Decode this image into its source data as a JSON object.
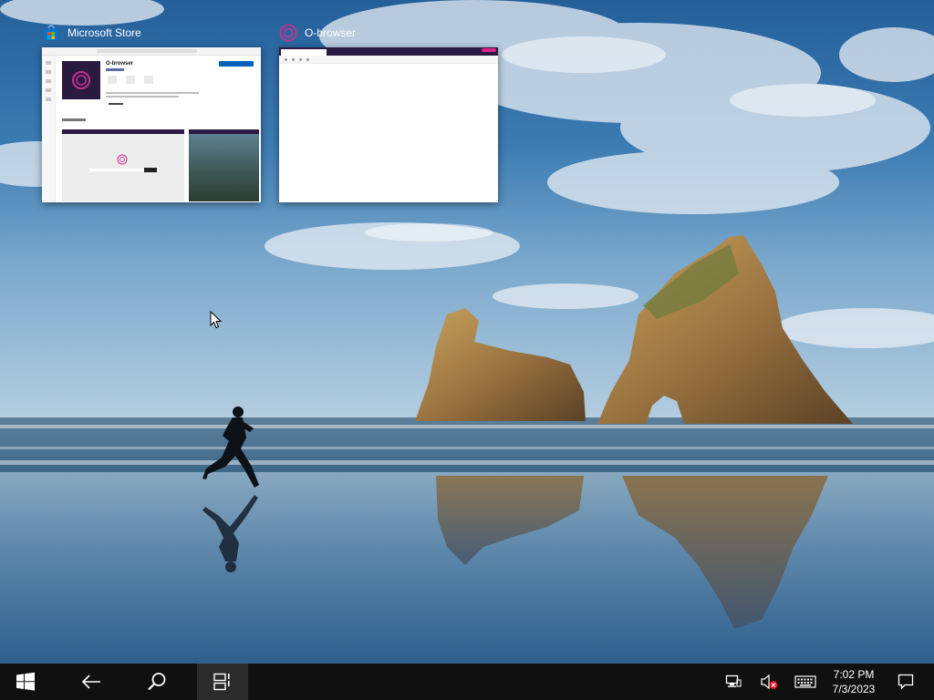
{
  "task_view": {
    "windows": [
      {
        "title": "Microsoft Store",
        "icon": "microsoft-store-icon",
        "thumbnail": {
          "app_name": "O-browser"
        }
      },
      {
        "title": "O-browser",
        "icon": "o-browser-icon"
      }
    ]
  },
  "taskbar": {
    "buttons": [
      "windows-start-icon",
      "back-arrow-icon",
      "search-icon",
      "task-view-icon"
    ],
    "tray_icons": [
      "network-icon",
      "volume-muted-icon",
      "touch-keyboard-icon"
    ],
    "clock": {
      "time": "7:02 PM",
      "date": "7/3/2023"
    },
    "notification_icon": "action-center-icon"
  },
  "colors": {
    "taskbar_bg": "#101010",
    "o_browser_brand": "#c2318d",
    "store_install_button": "#005fb8"
  }
}
